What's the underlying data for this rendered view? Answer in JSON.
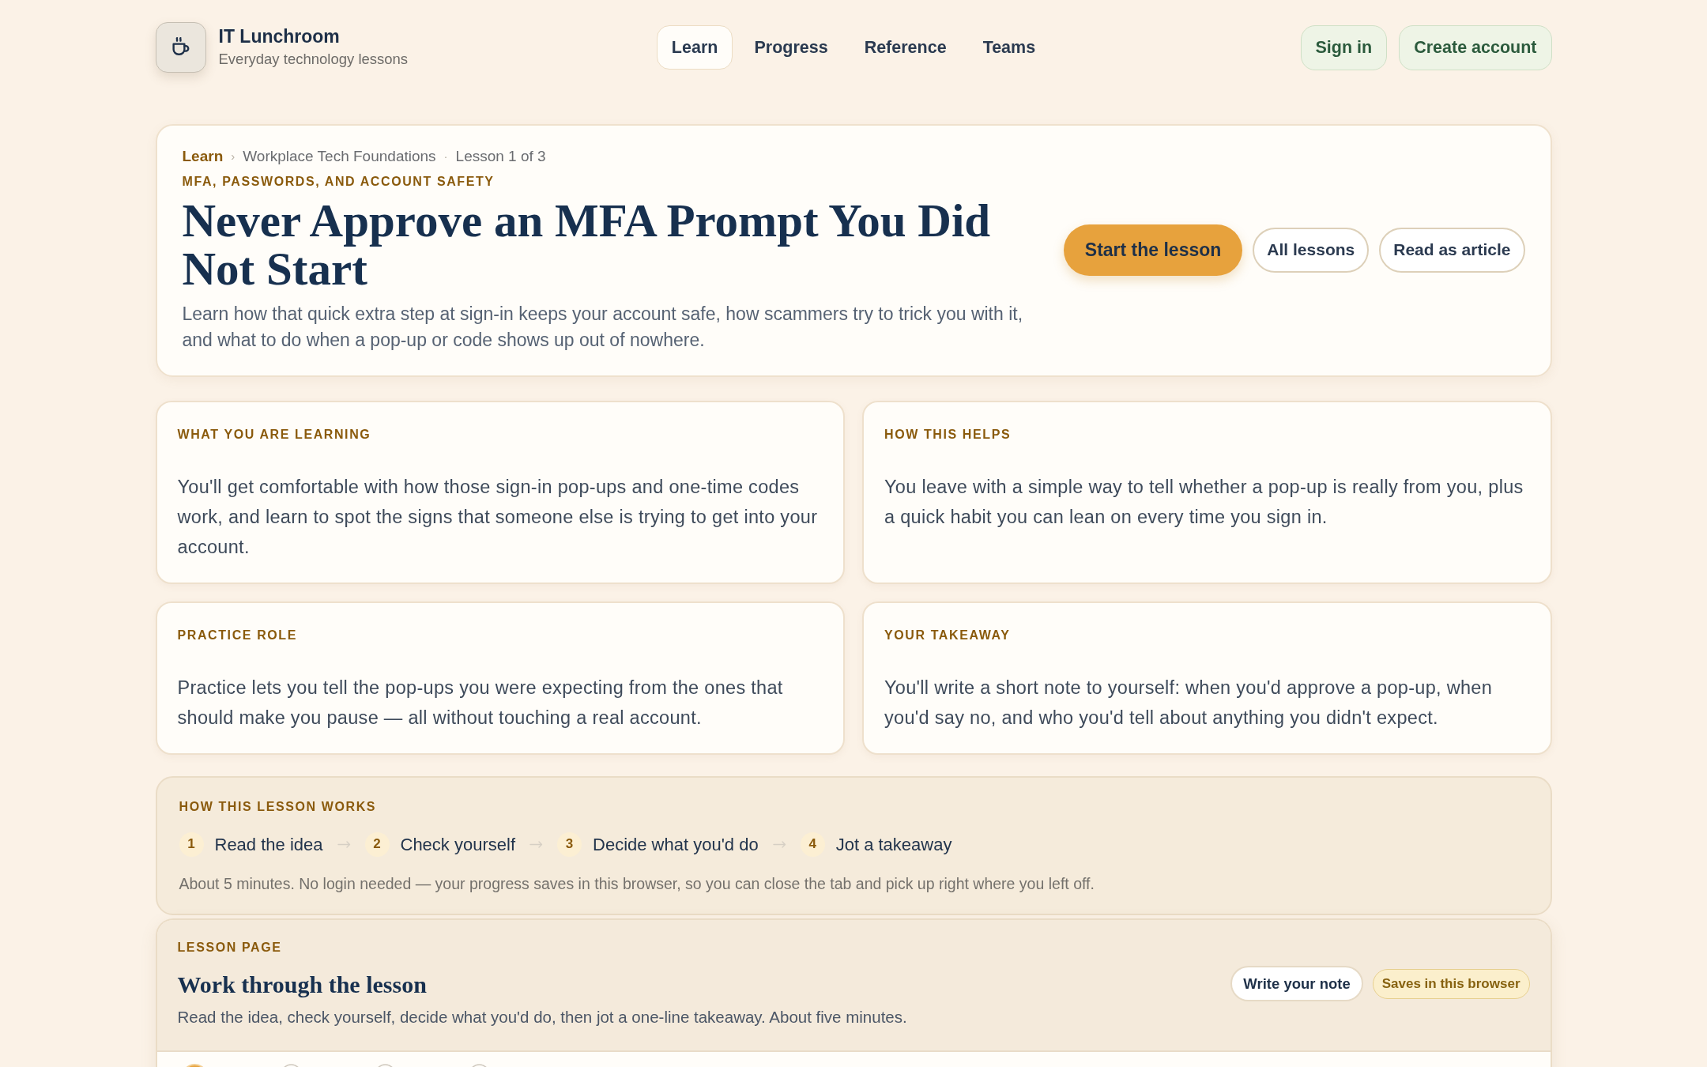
{
  "brand": {
    "name": "IT Lunchroom",
    "tagline": "Everyday technology lessons"
  },
  "nav": [
    {
      "label": "Learn",
      "selected": true
    },
    {
      "label": "Progress",
      "selected": false
    },
    {
      "label": "Reference",
      "selected": false
    },
    {
      "label": "Teams",
      "selected": false
    }
  ],
  "account_buttons": [
    "Sign in",
    "Create account"
  ],
  "hero": {
    "breadcrumb": [
      {
        "label": "Learn",
        "kind": "link"
      },
      {
        "label": "›",
        "kind": "separator"
      },
      {
        "label": "Workplace Tech Foundations",
        "kind": "text"
      },
      {
        "label": "·",
        "kind": "separator"
      },
      {
        "label": "Lesson 1 of 3",
        "kind": "text"
      }
    ],
    "eyebrow": "MFA, PASSWORDS, AND ACCOUNT SAFETY",
    "title": "Never Approve an MFA Prompt You Did Not Start",
    "description": "Learn how that quick extra step at sign-in keeps your account safe, how scammers try to trick you with it, and what to do when a pop-up or code shows up out of nowhere.",
    "buttons": [
      {
        "label": "Start the lesson",
        "kind": "primary"
      },
      {
        "label": "All lessons",
        "kind": "outline"
      },
      {
        "label": "Read as article",
        "kind": "outline"
      }
    ]
  },
  "info_cards": [
    {
      "heading": "WHAT YOU ARE LEARNING",
      "text": "You'll get comfortable with how those sign-in pop-ups and one-time codes work, and learn to spot the signs that someone else is trying to get into your account."
    },
    {
      "heading": "HOW THIS HELPS",
      "text": "You leave with a simple way to tell whether a pop-up is really from you, plus a quick habit you can lean on every time you sign in."
    },
    {
      "heading": "PRACTICE ROLE",
      "text": "Practice lets you tell the pop-ups you were expecting from the ones that should make you pause — all without touching a real account."
    },
    {
      "heading": "YOUR TAKEAWAY",
      "text": "You'll write a short note to yourself: when you'd approve a pop-up, when you'd say no, and who you'd tell about anything you didn't expect."
    }
  ],
  "how_it_works": {
    "heading": "HOW THIS LESSON WORKS",
    "steps": [
      {
        "number": "1",
        "label": "Read the idea"
      },
      {
        "number": "2",
        "label": "Check yourself"
      },
      {
        "number": "3",
        "label": "Decide what you'd do"
      },
      {
        "number": "4",
        "label": "Jot a takeaway"
      }
    ],
    "note": "About 5 minutes. No login needed — your progress saves in this browser, so you can close the tab and pick up right where you left off."
  },
  "lesson_page": {
    "eyebrow": "LESSON PAGE",
    "title": "Work through the lesson",
    "description": "Read the idea, check yourself, decide what you'd do, then jot a one-line takeaway. About five minutes.",
    "actions": [
      {
        "label": "Write your note",
        "kind": "button"
      },
      {
        "label": "Saves in this browser",
        "kind": "badge"
      }
    ],
    "progress_dots": [
      {
        "selected": true
      },
      {
        "selected": false
      },
      {
        "selected": false
      },
      {
        "selected": false
      }
    ]
  }
}
